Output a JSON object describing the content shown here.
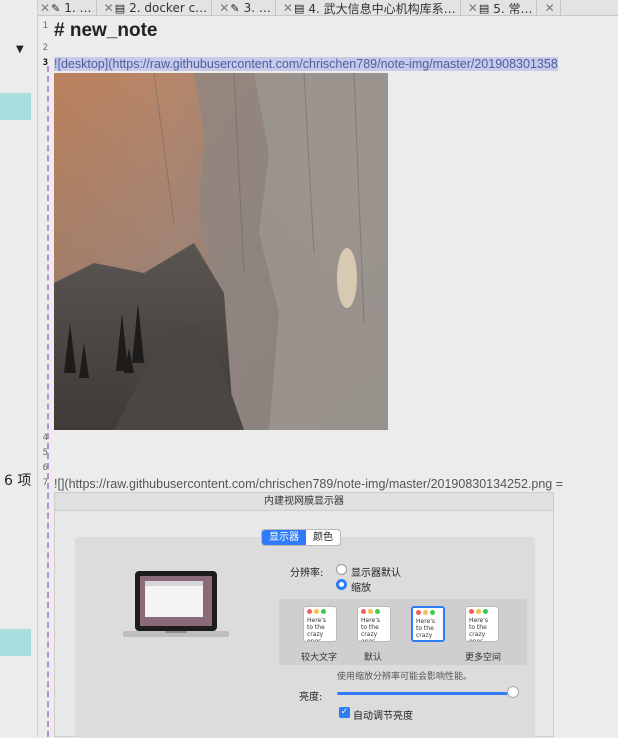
{
  "left_panel": {
    "collapse_icon": "caret-down-icon",
    "item_count": "6 项",
    "highlight_color": "#a8dedd"
  },
  "tabs": [
    {
      "label": "1. …",
      "icon": "pencil-icon"
    },
    {
      "label": "2. docker c…",
      "icon": "document-icon"
    },
    {
      "label": "3. …",
      "icon": "pencil-icon"
    },
    {
      "label": "4. 武大信息中心机构库系…",
      "icon": "document-icon"
    },
    {
      "label": "5. 常…",
      "icon": "document-icon"
    }
  ],
  "editor": {
    "line_numbers": [
      "1",
      "2",
      "3",
      "4",
      "5",
      "6",
      "7"
    ],
    "heading": "# new_note",
    "line3": "![desktop](https://raw.githubusercontent.com/chrischen789/note-img/master/201908301358",
    "line7": "![](https://raw.githubusercontent.com/chrischen789/note-img/master/20190830134252.png =",
    "image1_alt": "desktop",
    "selection_color": "#c9c9e9",
    "guide_color": "#b78ed8"
  },
  "display_dialog": {
    "title": "内建视网膜显示器",
    "segment_display": "显示器",
    "segment_color": "颜色",
    "resolution_label": "分辨率:",
    "option_default": "显示器默认",
    "option_scaled": "缩放",
    "thumb_text": "Here's to the crazy ones, the troublemakers. ones who see things differently.",
    "thumb_labels": [
      "较大文字",
      "默认",
      "",
      "更多空间"
    ],
    "perf_note": "使用缩放分辨率可能会影响性能。",
    "brightness_label": "亮度:",
    "brightness_level": 0.97,
    "auto_brightness": "自动调节亮度",
    "accent_color": "#2f7cf6"
  }
}
